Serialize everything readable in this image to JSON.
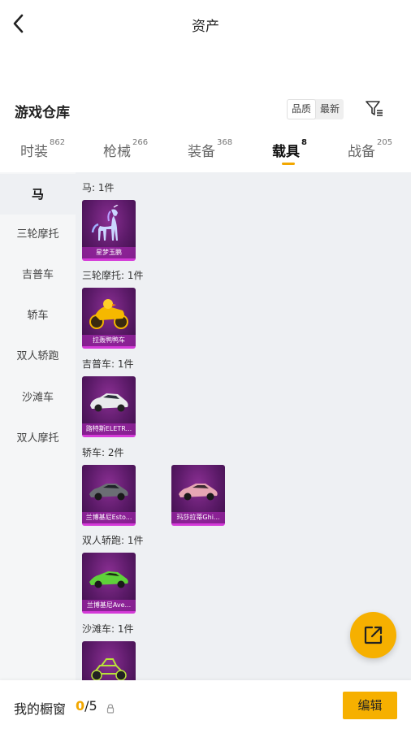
{
  "header": {
    "title": "资产"
  },
  "warehouse": {
    "title": "游戏仓库",
    "sort_options": [
      "品质",
      "最新"
    ],
    "sort_selected": "品质"
  },
  "tabs": [
    {
      "label": "时装",
      "count": "862"
    },
    {
      "label": "枪械",
      "count": "266"
    },
    {
      "label": "装备",
      "count": "368"
    },
    {
      "label": "载具",
      "count": "8"
    },
    {
      "label": "战备",
      "count": "205"
    }
  ],
  "active_tab": "载具",
  "sidebar": {
    "items": [
      "马",
      "三轮摩托",
      "吉普车",
      "轿车",
      "双人轿跑",
      "沙滩车",
      "双人摩托"
    ],
    "active": "马"
  },
  "sections": [
    {
      "title": "马: 1件",
      "items": [
        {
          "name": "星梦玉鹏",
          "icon": "unicorn-horse-icon"
        }
      ]
    },
    {
      "title": "三轮摩托: 1件",
      "items": [
        {
          "name": "拉轰鸭鸭车",
          "icon": "duck-trike-icon"
        }
      ]
    },
    {
      "title": "吉普车: 1件",
      "items": [
        {
          "name": "路特斯ELETR...",
          "icon": "white-suv-icon"
        }
      ]
    },
    {
      "title": "轿车: 2件",
      "items": [
        {
          "name": "兰博基尼Esto...",
          "icon": "grey-sports-car-icon"
        },
        {
          "name": "玛莎拉蒂Ghi...",
          "icon": "pink-sports-car-icon"
        }
      ]
    },
    {
      "title": "双人轿跑: 1件",
      "items": [
        {
          "name": "兰博基尼Ave...",
          "icon": "green-sports-car-icon"
        }
      ]
    },
    {
      "title": "沙滩车: 1件",
      "items": [
        {
          "name": "",
          "icon": "buggy-icon"
        }
      ]
    }
  ],
  "bottom": {
    "label": "我的橱窗",
    "current": "0",
    "total": "/5",
    "edit_label": "编辑"
  },
  "colors": {
    "accent": "#f6b000",
    "item_bg": "#5b1a68",
    "item_border": "#d43ad8"
  }
}
